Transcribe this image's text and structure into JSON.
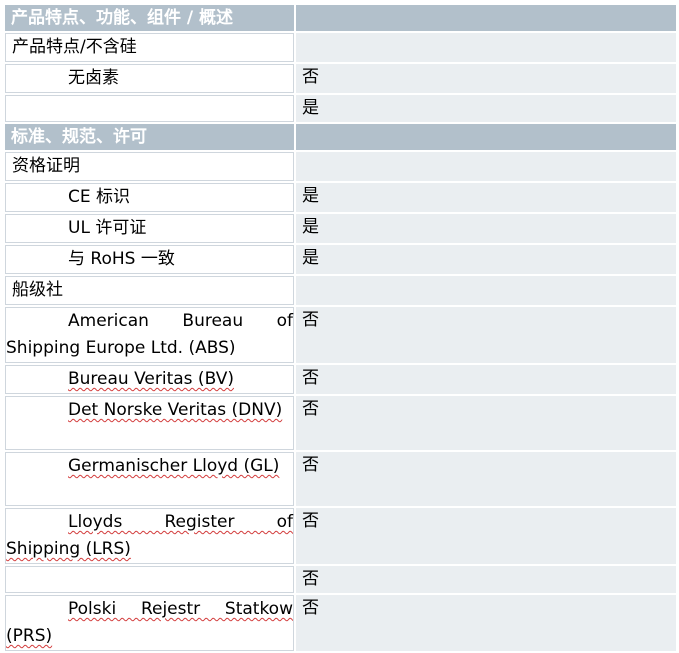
{
  "sections": [
    {
      "header": "产品特点、功能、组件 / 概述",
      "rows": [
        {
          "label": "产品特点/不含硅",
          "value": "",
          "level": 0
        },
        {
          "label": "无卤素",
          "value": "否",
          "level": 1
        },
        {
          "label": "",
          "value": "是",
          "level": 1
        }
      ]
    },
    {
      "header": "标准、规范、许可",
      "rows": [
        {
          "label": "资格证明",
          "value": "",
          "level": 0
        },
        {
          "label": "CE 标识",
          "value": "是",
          "level": 1
        },
        {
          "label": "UL 许可证",
          "value": "是",
          "level": 1
        },
        {
          "label": "与 RoHS 一致",
          "value": "是",
          "level": 1
        },
        {
          "label": "船级社",
          "value": "",
          "level": 0
        },
        {
          "label": "American Bureau of Shipping Europe Ltd. (ABS)",
          "value": "否",
          "level": 1
        },
        {
          "label": "Bureau Veritas (BV)",
          "value": "否",
          "level": 1
        },
        {
          "label": "Det Norske Veritas (DNV)",
          "value": "否",
          "level": 1
        },
        {
          "label": "Germanischer Lloyd (GL)",
          "value": "否",
          "level": 1
        },
        {
          "label": "Lloyds Register of Shipping (LRS)",
          "value": "否",
          "level": 1
        },
        {
          "label": "",
          "value": "否",
          "level": 1
        },
        {
          "label": "Polski Rejestr Statkow (PRS)",
          "value": "否",
          "level": 1
        }
      ]
    }
  ]
}
